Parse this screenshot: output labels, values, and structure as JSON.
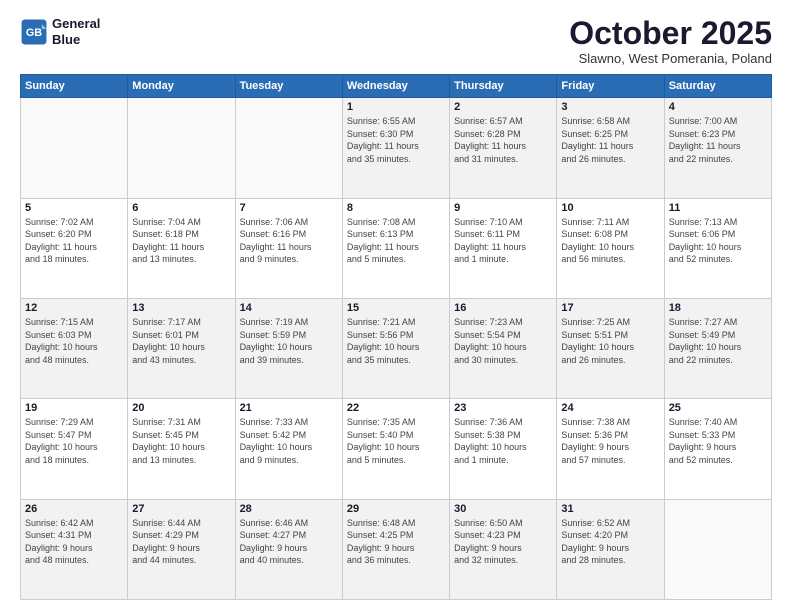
{
  "header": {
    "logo_line1": "General",
    "logo_line2": "Blue",
    "month": "October 2025",
    "location": "Slawno, West Pomerania, Poland"
  },
  "days_of_week": [
    "Sunday",
    "Monday",
    "Tuesday",
    "Wednesday",
    "Thursday",
    "Friday",
    "Saturday"
  ],
  "weeks": [
    [
      {
        "day": "",
        "info": ""
      },
      {
        "day": "",
        "info": ""
      },
      {
        "day": "",
        "info": ""
      },
      {
        "day": "1",
        "info": "Sunrise: 6:55 AM\nSunset: 6:30 PM\nDaylight: 11 hours\nand 35 minutes."
      },
      {
        "day": "2",
        "info": "Sunrise: 6:57 AM\nSunset: 6:28 PM\nDaylight: 11 hours\nand 31 minutes."
      },
      {
        "day": "3",
        "info": "Sunrise: 6:58 AM\nSunset: 6:25 PM\nDaylight: 11 hours\nand 26 minutes."
      },
      {
        "day": "4",
        "info": "Sunrise: 7:00 AM\nSunset: 6:23 PM\nDaylight: 11 hours\nand 22 minutes."
      }
    ],
    [
      {
        "day": "5",
        "info": "Sunrise: 7:02 AM\nSunset: 6:20 PM\nDaylight: 11 hours\nand 18 minutes."
      },
      {
        "day": "6",
        "info": "Sunrise: 7:04 AM\nSunset: 6:18 PM\nDaylight: 11 hours\nand 13 minutes."
      },
      {
        "day": "7",
        "info": "Sunrise: 7:06 AM\nSunset: 6:16 PM\nDaylight: 11 hours\nand 9 minutes."
      },
      {
        "day": "8",
        "info": "Sunrise: 7:08 AM\nSunset: 6:13 PM\nDaylight: 11 hours\nand 5 minutes."
      },
      {
        "day": "9",
        "info": "Sunrise: 7:10 AM\nSunset: 6:11 PM\nDaylight: 11 hours\nand 1 minute."
      },
      {
        "day": "10",
        "info": "Sunrise: 7:11 AM\nSunset: 6:08 PM\nDaylight: 10 hours\nand 56 minutes."
      },
      {
        "day": "11",
        "info": "Sunrise: 7:13 AM\nSunset: 6:06 PM\nDaylight: 10 hours\nand 52 minutes."
      }
    ],
    [
      {
        "day": "12",
        "info": "Sunrise: 7:15 AM\nSunset: 6:03 PM\nDaylight: 10 hours\nand 48 minutes."
      },
      {
        "day": "13",
        "info": "Sunrise: 7:17 AM\nSunset: 6:01 PM\nDaylight: 10 hours\nand 43 minutes."
      },
      {
        "day": "14",
        "info": "Sunrise: 7:19 AM\nSunset: 5:59 PM\nDaylight: 10 hours\nand 39 minutes."
      },
      {
        "day": "15",
        "info": "Sunrise: 7:21 AM\nSunset: 5:56 PM\nDaylight: 10 hours\nand 35 minutes."
      },
      {
        "day": "16",
        "info": "Sunrise: 7:23 AM\nSunset: 5:54 PM\nDaylight: 10 hours\nand 30 minutes."
      },
      {
        "day": "17",
        "info": "Sunrise: 7:25 AM\nSunset: 5:51 PM\nDaylight: 10 hours\nand 26 minutes."
      },
      {
        "day": "18",
        "info": "Sunrise: 7:27 AM\nSunset: 5:49 PM\nDaylight: 10 hours\nand 22 minutes."
      }
    ],
    [
      {
        "day": "19",
        "info": "Sunrise: 7:29 AM\nSunset: 5:47 PM\nDaylight: 10 hours\nand 18 minutes."
      },
      {
        "day": "20",
        "info": "Sunrise: 7:31 AM\nSunset: 5:45 PM\nDaylight: 10 hours\nand 13 minutes."
      },
      {
        "day": "21",
        "info": "Sunrise: 7:33 AM\nSunset: 5:42 PM\nDaylight: 10 hours\nand 9 minutes."
      },
      {
        "day": "22",
        "info": "Sunrise: 7:35 AM\nSunset: 5:40 PM\nDaylight: 10 hours\nand 5 minutes."
      },
      {
        "day": "23",
        "info": "Sunrise: 7:36 AM\nSunset: 5:38 PM\nDaylight: 10 hours\nand 1 minute."
      },
      {
        "day": "24",
        "info": "Sunrise: 7:38 AM\nSunset: 5:36 PM\nDaylight: 9 hours\nand 57 minutes."
      },
      {
        "day": "25",
        "info": "Sunrise: 7:40 AM\nSunset: 5:33 PM\nDaylight: 9 hours\nand 52 minutes."
      }
    ],
    [
      {
        "day": "26",
        "info": "Sunrise: 6:42 AM\nSunset: 4:31 PM\nDaylight: 9 hours\nand 48 minutes."
      },
      {
        "day": "27",
        "info": "Sunrise: 6:44 AM\nSunset: 4:29 PM\nDaylight: 9 hours\nand 44 minutes."
      },
      {
        "day": "28",
        "info": "Sunrise: 6:46 AM\nSunset: 4:27 PM\nDaylight: 9 hours\nand 40 minutes."
      },
      {
        "day": "29",
        "info": "Sunrise: 6:48 AM\nSunset: 4:25 PM\nDaylight: 9 hours\nand 36 minutes."
      },
      {
        "day": "30",
        "info": "Sunrise: 6:50 AM\nSunset: 4:23 PM\nDaylight: 9 hours\nand 32 minutes."
      },
      {
        "day": "31",
        "info": "Sunrise: 6:52 AM\nSunset: 4:20 PM\nDaylight: 9 hours\nand 28 minutes."
      },
      {
        "day": "",
        "info": ""
      }
    ]
  ]
}
